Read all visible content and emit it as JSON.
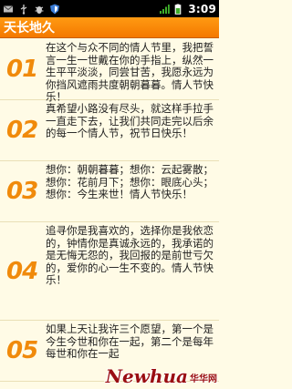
{
  "status_bar": {
    "time": "3:09",
    "icons": [
      "mail-icon",
      "usb-icon",
      "debug-icon",
      "shield-icon",
      "signal-icon",
      "battery-icon"
    ]
  },
  "app": {
    "title": "天长地久",
    "accent": "#f47900",
    "number_color": "#f08a0b"
  },
  "items": [
    {
      "num": "01",
      "text": "在这个与众不同的情人节里，我把誓言一生一世戴在你的手指上，纵然一生平平淡淡，同尝甘苦，我愿永远为你挡风遮雨共度朝朝暮暮。情人节快乐！"
    },
    {
      "num": "02",
      "text": "真希望小路没有尽头，就这样手拉手一直走下去，让我们共同走完以后余的每一个情人节，祝节日快乐！"
    },
    {
      "num": "03",
      "text": "想你：朝朝暮暮；想你：云起雾散；想你：花前月下；想你：眼底心头；想你：今生来世！情人节快乐！"
    },
    {
      "num": "04",
      "text": "追寻你是我喜欢的，选择你是我依恋的，钟情你是真诚永远的，我承诺的是无悔无怨的，我回报的是前世亏欠的，爱你的心一生不变的。情人节快乐！"
    },
    {
      "num": "05",
      "text": "如果上天让我许三个愿望，第一个是今生今世和你在一起，第二个是每年每世和你在一起"
    }
  ],
  "watermark": {
    "logo": "Newhua",
    "cn": "华华网"
  }
}
